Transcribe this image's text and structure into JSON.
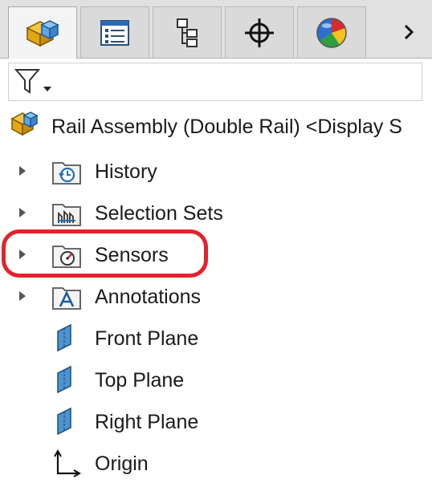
{
  "tabs": [
    {
      "name": "FeatureManager design tree",
      "icon": "assembly-cube-icon",
      "active": true
    },
    {
      "name": "PropertyManager",
      "icon": "property-list-icon",
      "active": false
    },
    {
      "name": "ConfigurationManager",
      "icon": "configuration-tree-icon",
      "active": false
    },
    {
      "name": "DimXpertManager",
      "icon": "crosshair-icon",
      "active": false
    },
    {
      "name": "DisplayManager",
      "icon": "color-wheel-icon",
      "active": false
    }
  ],
  "tab_more_icon": "chevron-right-icon",
  "filter": {
    "icon": "filter-funnel-icon"
  },
  "tree": {
    "root": {
      "label": "Rail Assembly (Double Rail) <Display S",
      "icon": "assembly-icon"
    },
    "items": [
      {
        "label": "History",
        "icon": "history-folder-icon",
        "expandable": true
      },
      {
        "label": "Selection Sets",
        "icon": "selection-sets-folder-icon",
        "expandable": true
      },
      {
        "label": "Sensors",
        "icon": "sensors-folder-icon",
        "expandable": true,
        "highlighted": true
      },
      {
        "label": "Annotations",
        "icon": "annotations-folder-icon",
        "expandable": true
      },
      {
        "label": "Front Plane",
        "icon": "plane-icon",
        "expandable": false
      },
      {
        "label": "Top Plane",
        "icon": "plane-icon",
        "expandable": false
      },
      {
        "label": "Right Plane",
        "icon": "plane-icon",
        "expandable": false
      },
      {
        "label": "Origin",
        "icon": "origin-icon",
        "expandable": false
      }
    ]
  },
  "colors": {
    "highlight": "#e0232d",
    "accent_blue": "#1d6fb8",
    "icon_yellow": "#f2b51d"
  }
}
